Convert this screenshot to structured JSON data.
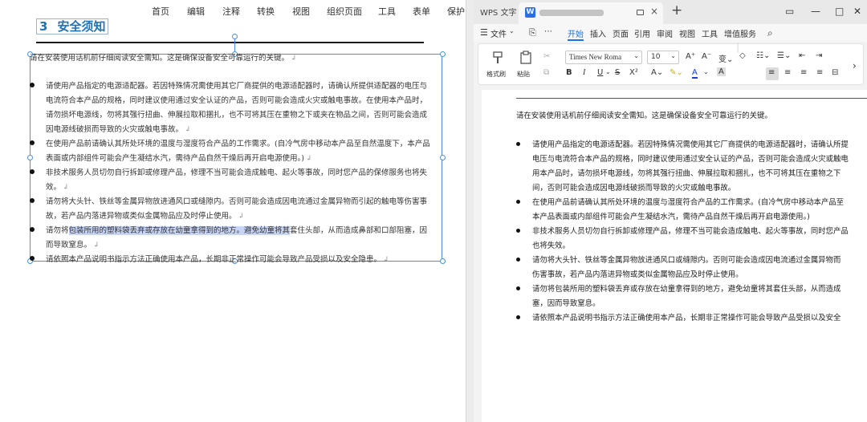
{
  "left_window": {
    "menu": [
      "首页",
      "编辑",
      "注释",
      "转换",
      "视图",
      "组织页面",
      "工具",
      "表单",
      "保护"
    ],
    "heading": {
      "number": "3",
      "title": "安全须知"
    },
    "intro": "请在安装使用话机前仔细阅读安全需知。这是确保设备安全可靠运行的关键。",
    "bullets": [
      {
        "text": "请使用产品指定的电源适配器。若因特殊情况需使用其它厂商提供的电源适配器时，请确认所提供适配器的电压与电流符合本产品的规格，同时建议使用通过安全认证的产品，否则可能会造成火灾或触电事故。在使用本产品时，请勿损坏电源线，勿将其强行扭曲、伸展拉取和捆扎，也不可将其压在重物之下或夹在物品之间，否则可能会造成因电源线破损而导致的火灾或触电事故。"
      },
      {
        "text": "在使用产品前请确认其所处环境的温度与湿度符合产品的工作需求。(自冷气房中移动本产品至自然温度下，本产品表面或内部组件可能会产生凝结水汽，需待产品自然干燥后再开启电源使用。)"
      },
      {
        "text": "非技术服务人员切勿自行拆卸或修理产品，修理不当可能会造成触电、起火等事故，同时您产品的保修服务也将失效。"
      },
      {
        "text": "请勿将大头针、铁丝等金属异物放进通风口或缝隙内。否则可能会造成因电流通过金属异物而引起的触电等伤害事故，若产品内落进异物或类似金属物品应及时停止使用。"
      },
      {
        "pre": "请勿将",
        "highlight": "包装所用的塑料袋丢弃或存放在幼童拿得到的地方。避免幼童将其",
        "post": "套住头部，从而造成鼻部和口部阻塞，因而导致窒息。"
      },
      {
        "text": "请依照本产品说明书指示方法正确使用本产品，长期非正常操作可能会导致产品受损以及安全隐患。"
      }
    ]
  },
  "right_window": {
    "app_name": "WPS 文字",
    "doc_icon_letter": "W",
    "tab_close": "×",
    "new_tab": "+",
    "window_controls": [
      "▭",
      "—",
      "□",
      "✕"
    ],
    "menu": [
      "文件",
      "开始",
      "插入",
      "页面",
      "引用",
      "审阅",
      "视图",
      "工具",
      "增值服务"
    ],
    "active_menu": "开始",
    "ribbon": {
      "format_painter": "格式刷",
      "paste": "粘贴",
      "font_name": "Times New Roma",
      "font_size": "10",
      "bold": "B",
      "italic": "I",
      "underline": "U",
      "strike": "S",
      "superscript": "X²",
      "font_color": "A"
    },
    "document": {
      "intro": "请在安装使用话机前仔细阅读安全需知。这是确保设备安全可靠运行的关键。",
      "bullets": [
        [
          "请使用产品指定的电源适配器。若因特殊情况需使用其它厂商提供的电源适配器时，请确认所提",
          "电压与电流符合本产品的规格，同时建议使用通过安全认证的产品，否则可能会造成火灾或触电",
          "用本产品时，请勿损坏电源线，勿将其强行扭曲、伸展拉取和捆扎，也不可将其压在重物之下",
          "间，否则可能会造成因电源线破损而导致的火灾或触电事故。"
        ],
        [
          "在使用产品前请确认其所处环境的温度与湿度符合产品的工作需求。(自冷气房中移动本产品至",
          "本产品表面或内部组件可能会产生凝结水汽，需待产品自然干燥后再开启电源使用。)"
        ],
        [
          "非技术服务人员切勿自行拆卸或修理产品，修理不当可能会造成触电、起火等事故，同时您产品",
          "也将失效。"
        ],
        [
          "请勿将大头针、铁丝等金属异物放进通风口或缝隙内。否则可能会造成因电流通过金属异物而",
          "伤害事故，若产品内落进异物或类似金属物品应及时停止使用。"
        ],
        [
          "请勿将包装所用的塑料袋丢弃或存放在幼童拿得到的地方，避免幼童将其套住头部，从而造成",
          "塞，因而导致窒息。"
        ],
        [
          "请依照本产品说明书指示方法正确使用本产品，长期非正常操作可能会导致产品受损以及安全"
        ]
      ]
    }
  },
  "colors": {
    "accent": "#1a73e8",
    "heading": "#1d72b8",
    "highlight": "#c9d5f4",
    "selection": "#4a90d9"
  }
}
